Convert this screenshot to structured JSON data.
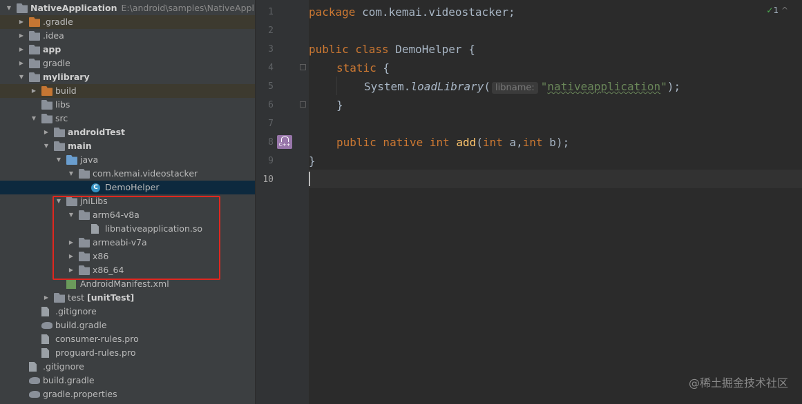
{
  "project": {
    "root_name": "NativeApplication",
    "root_path": "E:\\android\\samples\\NativeApplicati",
    "items": [
      {
        "label": "NativeApplication"
      },
      {
        "label": ".gradle"
      },
      {
        "label": ".idea"
      },
      {
        "label": "app"
      },
      {
        "label": "gradle"
      },
      {
        "label": "mylibrary"
      },
      {
        "label": "build"
      },
      {
        "label": "libs"
      },
      {
        "label": "src"
      },
      {
        "label": "androidTest"
      },
      {
        "label": "main"
      },
      {
        "label": "java"
      },
      {
        "label": "com.kemai.videostacker"
      },
      {
        "label": "DemoHelper"
      },
      {
        "label": "jniLibs"
      },
      {
        "label": "arm64-v8a"
      },
      {
        "label": "libnativeapplication.so"
      },
      {
        "label": "armeabi-v7a"
      },
      {
        "label": "x86"
      },
      {
        "label": "x86_64"
      },
      {
        "label": "AndroidManifest.xml"
      },
      {
        "label": "test",
        "suffix": "[unitTest]"
      },
      {
        "label": ".gitignore"
      },
      {
        "label": "build.gradle"
      },
      {
        "label": "consumer-rules.pro"
      },
      {
        "label": "proguard-rules.pro"
      },
      {
        "label": ".gitignore"
      },
      {
        "label": "build.gradle"
      },
      {
        "label": "gradle.properties"
      }
    ]
  },
  "editor": {
    "line_numbers": [
      "1",
      "2",
      "3",
      "4",
      "5",
      "6",
      "7",
      "8",
      "9",
      "10"
    ],
    "lines": {
      "l1_kw": "package",
      "l1_rest": " com.kemai.videostacker;",
      "l3_kw": "public class",
      "l3_rest": " DemoHelper {",
      "l4_kw": "static",
      "l4_rest": " {",
      "l5_obj": "System.",
      "l5_method": "loadLibrary",
      "l5_open": "(",
      "l5_hint": "libname:",
      "l5_str_q1": "\"",
      "l5_str": "nativeapplication",
      "l5_str_q2": "\"",
      "l5_close": ");",
      "l6": "}",
      "l8_kw1": "public native int",
      "l8_fn": "add",
      "l8_open": "(",
      "l8_kw2": "int",
      "l8_a": " a,",
      "l8_kw3": "int",
      "l8_b": " b);",
      "l9": "}"
    },
    "inspection_count": "1",
    "gutter_icon": "C++"
  },
  "watermark": "@稀土掘金技术社区",
  "colors": {
    "keyword": "#cc7832",
    "string": "#6a8759",
    "function": "#ffc66d",
    "highlight_box": "#e0271f",
    "selection": "#0d293e"
  }
}
